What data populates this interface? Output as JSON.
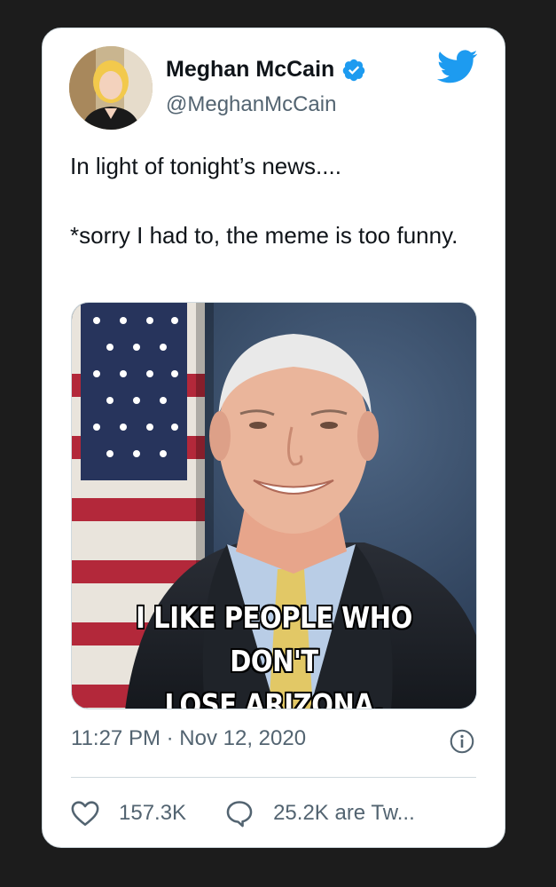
{
  "tweet": {
    "author_name": "Meghan McCain",
    "author_handle": "@MeghanMcCain",
    "text_lines": [
      "In light of tonight’s news....",
      "*sorry I had to, the meme is too funny."
    ],
    "image_caption_line1": "I LIKE PEOPLE WHO DON'T",
    "image_caption_line2": "LOSE ARIZONA.",
    "timestamp": "11:27 PM · Nov 12, 2020",
    "likes": "157.3K",
    "replies": "25.2K are Tw..."
  },
  "icons": {
    "verified": "verified-badge-icon",
    "brand": "twitter-bird-icon",
    "info": "info-icon",
    "like": "heart-icon",
    "reply": "speech-bubble-icon"
  },
  "colors": {
    "brand_blue": "#1d9bf0",
    "text": "#0f1419",
    "muted": "#536471",
    "background": "#1c1c1c"
  }
}
